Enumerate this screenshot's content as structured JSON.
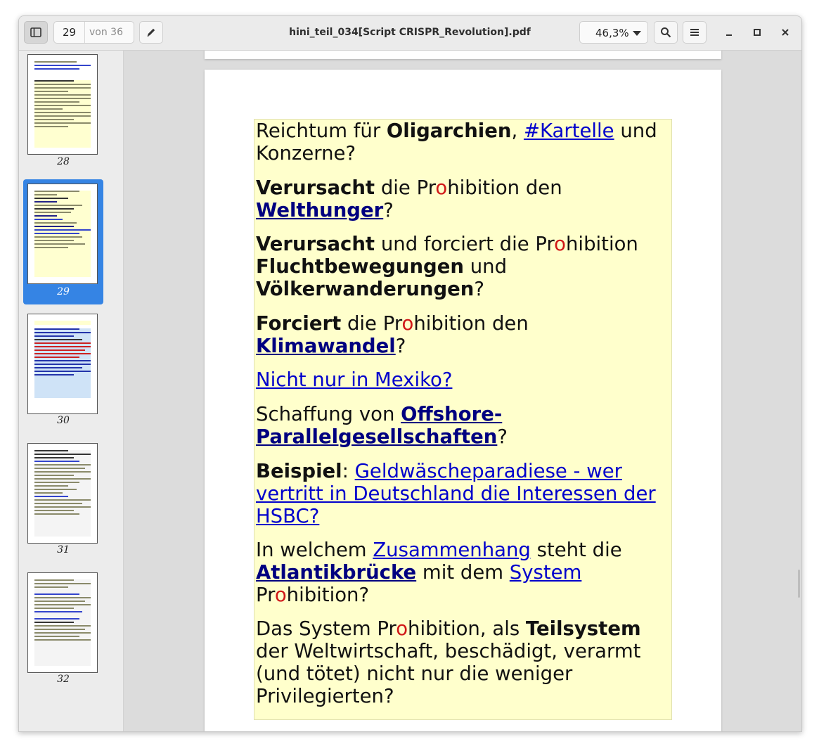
{
  "window": {
    "title": "hini_teil_034[Script CRISPR_Revolution].pdf"
  },
  "toolbar": {
    "current_page": "29",
    "total_pages": "von 36",
    "zoom_value": "46,3%"
  },
  "thumbnails": [
    {
      "label": "28",
      "selected": false
    },
    {
      "label": "29",
      "selected": true
    },
    {
      "label": "30",
      "selected": false
    },
    {
      "label": "31",
      "selected": false
    },
    {
      "label": "32",
      "selected": false
    }
  ],
  "page": {
    "p1": {
      "t1": "Reichtum für ",
      "b1": "Oligarchien",
      "t2": ", ",
      "link1": "#Kartelle",
      "t3": " und Konzerne?"
    },
    "p2": {
      "b1": "Verursacht",
      "t1": " die Pr",
      "o": "o",
      "t2": "hibition den ",
      "link1": "Welthunger",
      "t3": "?"
    },
    "p3": {
      "b1": "Verursacht",
      "t1": " und forciert die Pr",
      "o": "o",
      "t2": "hibition ",
      "b2": "Fluchtbewegungen",
      "t3": " und ",
      "b3": "Völkerwanderungen",
      "t4": "?"
    },
    "p4": {
      "b1": "Forciert",
      "t1": " die Pr",
      "o": "o",
      "t2": "hibition den ",
      "link1": "Klimawandel",
      "t3": "?"
    },
    "p5": {
      "link1": "Nicht nur in Mexiko?"
    },
    "p6": {
      "t1": "Schaffung von ",
      "link1": "Offshore-Parallelgesellschaften",
      "t2": "?"
    },
    "p7": {
      "b1": "Beispiel",
      "t1": ": ",
      "link1": "Geldwäscheparadiese - wer vertritt in Deutschland die Interessen der HSBC?"
    },
    "p8": {
      "t1": "In welchem ",
      "link1": "Zusammenhang",
      "t2": " steht die ",
      "link2": "Atlantikbrücke",
      "t3": " mit dem ",
      "link3": "System",
      "t4": " Pr",
      "o": "o",
      "t5": "hibition?"
    },
    "p9": {
      "t1": "Das System Pr",
      "o": "o",
      "t2": "hibition, als ",
      "b1": "Teilsystem",
      "t3": " der Weltwirtschaft, beschädigt, verarmt (und tötet) nicht nur die weniger Privilegierten?"
    }
  },
  "colors": {
    "highlight_box": "#ffffcc",
    "link": "#0000cc",
    "bold_link": "#000080",
    "red_o": "#d01818",
    "selection": "#3584e4"
  },
  "icons": [
    "sidebar-toggle-icon",
    "pencil-icon",
    "search-icon",
    "hamburger-menu-icon",
    "minimize-icon",
    "maximize-icon",
    "close-icon",
    "grid-view-icon",
    "outline-icon",
    "annotations-icon",
    "bookmark-icon"
  ]
}
